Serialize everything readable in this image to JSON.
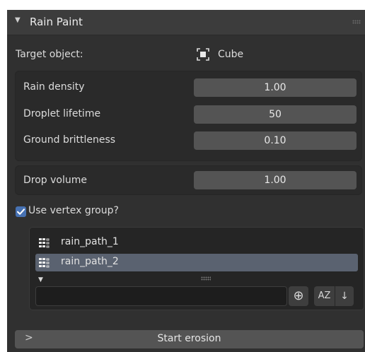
{
  "panel": {
    "title": "Rain Paint",
    "collapse_glyph": "▼"
  },
  "target": {
    "label": "Target object:",
    "value": "Cube",
    "icon": "object-icon"
  },
  "params": {
    "rain_density": {
      "label": "Rain density",
      "value": "1.00"
    },
    "droplet_lifetime": {
      "label": "Droplet lifetime",
      "value": "50"
    },
    "ground_brittleness": {
      "label": "Ground brittleness",
      "value": "0.10"
    },
    "drop_volume": {
      "label": "Drop volume",
      "value": "1.00"
    }
  },
  "vertex_group": {
    "label": "Use vertex group?",
    "checked": true,
    "items": [
      {
        "name": "rain_path_1",
        "active": false,
        "icon": "vertex-group-icon"
      },
      {
        "name": "rain_path_2",
        "active": true,
        "icon": "vertex-group-icon"
      }
    ],
    "expand_glyph": "▼",
    "filter_value": "",
    "add_glyph": "⊕",
    "sort_alpha_glyph": "AZ",
    "sort_dir_glyph": "↓"
  },
  "erosion": {
    "label": "Start erosion",
    "chevron": ">"
  },
  "colors": {
    "accent": "#4772b3",
    "panel_bg": "#303030",
    "field_bg": "#545454",
    "active_row": "#5a6270"
  }
}
